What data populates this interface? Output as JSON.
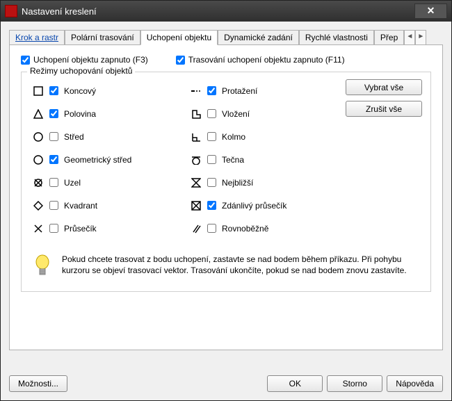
{
  "window": {
    "title": "Nastavení kreslení"
  },
  "tabs": {
    "t0": "Krok a rastr",
    "t1": "Polární trasování",
    "t2": "Uchopení objektu",
    "t3": "Dynamické zadání",
    "t4": "Rychlé vlastnosti",
    "t5": "Přep"
  },
  "top": {
    "osnap_on": "Uchopení objektu zapnuto (F3)",
    "otrack_on": "Trasování uchopení objektu zapnuto (F11)"
  },
  "group_title": "Režimy uchopování objektů",
  "left": {
    "endpoint": "Koncový",
    "midpoint": "Polovina",
    "center": "Střed",
    "geocenter": "Geometrický střed",
    "node": "Uzel",
    "quadrant": "Kvadrant",
    "intersection": "Průsečík"
  },
  "right": {
    "extension": "Protažení",
    "insertion": "Vložení",
    "perpendicular": "Kolmo",
    "tangent": "Tečna",
    "nearest": "Nejbližší",
    "apparent": "Zdánlivý průsečík",
    "parallel": "Rovnoběžně"
  },
  "buttons": {
    "select_all": "Vybrat vše",
    "clear_all": "Zrušit vše"
  },
  "tip": "Pokud chcete trasovat z bodu uchopení, zastavte se nad bodem během příkazu. Při pohybu kurzoru se objeví trasovací vektor. Trasování ukončíte, pokud se nad bodem znovu zastavíte.",
  "footer": {
    "options": "Možnosti...",
    "ok": "OK",
    "cancel": "Storno",
    "help": "Nápověda"
  }
}
